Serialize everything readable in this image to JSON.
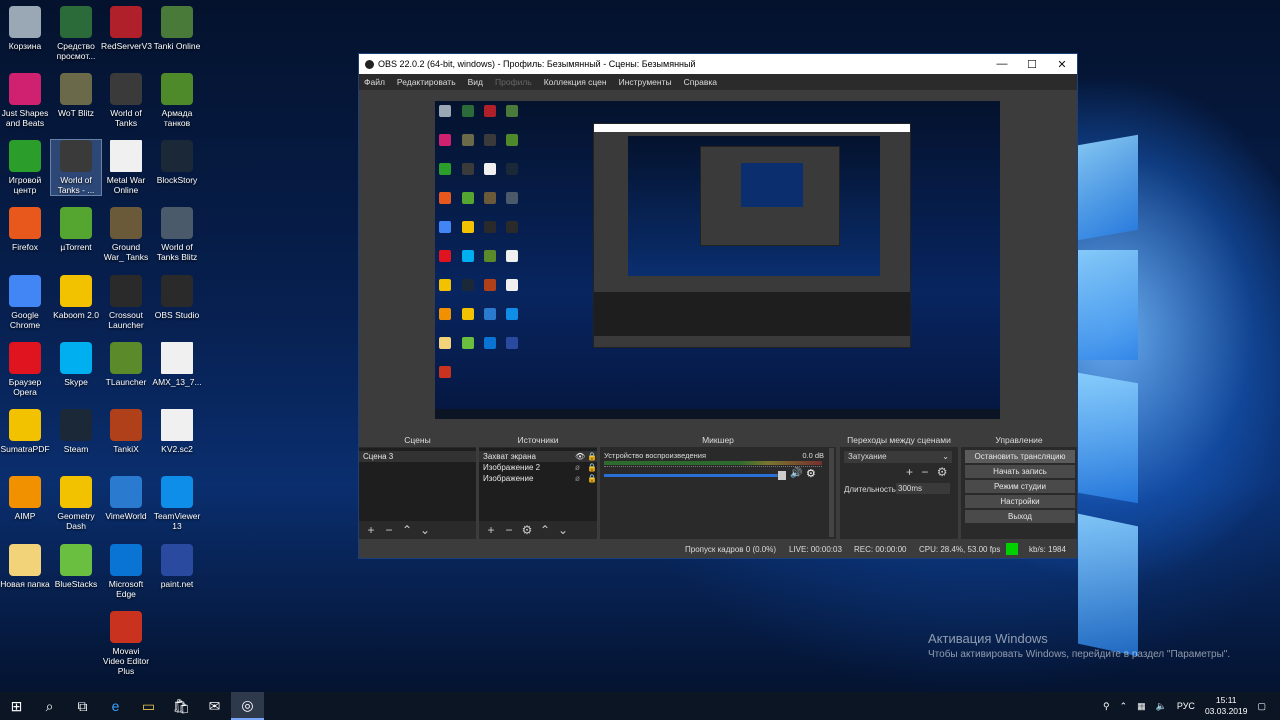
{
  "desktop_icons": [
    {
      "label": "Корзина",
      "icon": "recycle-bin-icon",
      "color": "#9aa7b5"
    },
    {
      "label": "Средство просмот...",
      "icon": "photo-viewer-icon",
      "color": "#2b6b3a"
    },
    {
      "label": "RedServerV3",
      "icon": "cube-icon",
      "color": "#b0202a"
    },
    {
      "label": "Tanki Online",
      "icon": "tanki-online-icon",
      "color": "#4a7a3a"
    },
    {
      "label": "Just Shapes and Beats",
      "icon": "just-shapes-beats-icon",
      "color": "#d02070"
    },
    {
      "label": "WoT Blitz",
      "icon": "tank-icon",
      "color": "#6a6a4a"
    },
    {
      "label": "World of Tanks",
      "icon": "wot-icon",
      "color": "#3a3a3a"
    },
    {
      "label": "Армада танков",
      "icon": "armada-icon",
      "color": "#4f8a2a"
    },
    {
      "label": "Игровой центр",
      "icon": "game-center-icon",
      "color": "#2a9d2a"
    },
    {
      "label": "World of Tanks - ...",
      "icon": "wot-shortcut-icon",
      "color": "#3a3a3a"
    },
    {
      "label": "Metal War Online",
      "icon": "file-icon",
      "color": "#f0f0f0"
    },
    {
      "label": "BlockStory",
      "icon": "steam-icon",
      "color": "#1b2838"
    },
    {
      "label": "Firefox",
      "icon": "firefox-icon",
      "color": "#e8571b"
    },
    {
      "label": "µTorrent",
      "icon": "utorrent-icon",
      "color": "#55a630"
    },
    {
      "label": "Ground War_ Tanks",
      "icon": "ground-war-icon",
      "color": "#6b5a3a"
    },
    {
      "label": "World of Tanks Blitz",
      "icon": "wot-blitz-icon",
      "color": "#4a5a6a"
    },
    {
      "label": "Google Chrome",
      "icon": "chrome-icon",
      "color": "#4285f4"
    },
    {
      "label": "Kaboom 2.0",
      "icon": "bomb-icon",
      "color": "#f2c200"
    },
    {
      "label": "Crossout Launcher",
      "icon": "crossout-icon",
      "color": "#2a2a2a"
    },
    {
      "label": "OBS Studio",
      "icon": "obs-icon",
      "color": "#2a2a2a"
    },
    {
      "label": "Браузер Opera",
      "icon": "opera-icon",
      "color": "#e0141e"
    },
    {
      "label": "Skype",
      "icon": "skype-icon",
      "color": "#00aff0"
    },
    {
      "label": "TLauncher",
      "icon": "minecraft-icon",
      "color": "#5a8a2a"
    },
    {
      "label": "AMX_13_7...",
      "icon": "file-icon",
      "color": "#f0f0f0"
    },
    {
      "label": "SumatraPDF",
      "icon": "pdf-icon",
      "color": "#f2c200"
    },
    {
      "label": "Steam",
      "icon": "steam-icon",
      "color": "#1b2838"
    },
    {
      "label": "TankiX",
      "icon": "tankix-icon",
      "color": "#b0401a"
    },
    {
      "label": "KV2.sc2",
      "icon": "file-icon",
      "color": "#f0f0f0"
    },
    {
      "label": "AIMP",
      "icon": "aimp-icon",
      "color": "#f29100"
    },
    {
      "label": "Geometry Dash",
      "icon": "geometry-dash-icon",
      "color": "#f2c200"
    },
    {
      "label": "VimeWorld",
      "icon": "vimeworld-icon",
      "color": "#2a7ad0"
    },
    {
      "label": "TeamViewer 13",
      "icon": "teamviewer-icon",
      "color": "#0e8ee9"
    },
    {
      "label": "Новая папка",
      "icon": "folder-icon",
      "color": "#f2d37a"
    },
    {
      "label": "BlueStacks",
      "icon": "bluestacks-icon",
      "color": "#6abf40"
    },
    {
      "label": "Microsoft Edge",
      "icon": "edge-icon",
      "color": "#0a74d4"
    },
    {
      "label": "paint.net",
      "icon": "paintnet-icon",
      "color": "#2a4aa0"
    },
    {
      "label": "Movavi Video Editor Plus",
      "icon": "movavi-icon",
      "color": "#c8321e"
    }
  ],
  "obs": {
    "title": "OBS 22.0.2 (64-bit, windows) - Профиль: Безымянный - Сцены: Безымянный",
    "menu": [
      "Файл",
      "Редактировать",
      "Вид",
      "Профиль",
      "Коллекция сцен",
      "Инструменты",
      "Справка"
    ],
    "docks": {
      "scenes": {
        "title": "Сцены",
        "items": [
          "Сцена 3"
        ]
      },
      "sources": {
        "title": "Источники",
        "items": [
          "Захват экрана",
          "Изображение 2",
          "Изображение"
        ]
      },
      "mixer": {
        "title": "Микшер",
        "device": "Устройство воспроизведения",
        "db": "0.0 dB",
        "level": 0.95
      },
      "transitions": {
        "title": "Переходы между сценами",
        "type": "Затухание",
        "duration_label": "Длительность",
        "duration": "300ms"
      },
      "controls": {
        "title": "Управление",
        "buttons": [
          "Остановить трансляцию",
          "Начать запись",
          "Режим студии",
          "Настройки",
          "Выход"
        ]
      }
    },
    "status": {
      "dropped": "Пропуск кадров 0 (0.0%)",
      "live": "LIVE: 00:00:03",
      "rec": "REC: 00:00:00",
      "cpu": "CPU: 28.4%, 53.00 fps",
      "kbs": "kb/s: 1984",
      "indicator_color": "#00d000"
    }
  },
  "activation": {
    "line1": "Активация Windows",
    "line2": "Чтобы активировать Windows, перейдите в раздел \"Параметры\"."
  },
  "taskbar": {
    "lang": "РУС",
    "time": "15:11",
    "date": "03.03.2019"
  }
}
